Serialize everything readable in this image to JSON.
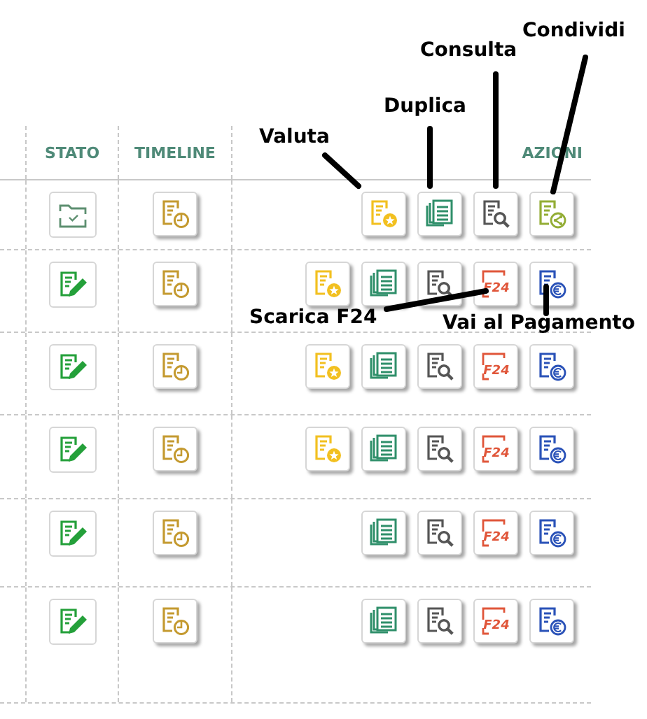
{
  "table": {
    "columns": [
      {
        "label": "STATO"
      },
      {
        "label": "TIMELINE"
      },
      {
        "label": "AZIONI"
      }
    ],
    "rows": [
      {
        "stato": {
          "kind": "folder-check"
        },
        "actions": [
          {
            "kind": "valuta"
          },
          {
            "kind": "duplica"
          },
          {
            "kind": "consulta"
          },
          {
            "kind": "condividi"
          }
        ]
      },
      {
        "stato": {
          "kind": "edit"
        },
        "actions": [
          {
            "kind": "valuta"
          },
          {
            "kind": "duplica"
          },
          {
            "kind": "consulta"
          },
          {
            "kind": "f24",
            "text": "F24"
          },
          {
            "kind": "pagamento"
          }
        ]
      },
      {
        "stato": {
          "kind": "edit"
        },
        "actions": [
          {
            "kind": "valuta"
          },
          {
            "kind": "duplica"
          },
          {
            "kind": "consulta"
          },
          {
            "kind": "f24",
            "text": "F24"
          },
          {
            "kind": "pagamento"
          }
        ]
      },
      {
        "stato": {
          "kind": "edit"
        },
        "actions": [
          {
            "kind": "valuta"
          },
          {
            "kind": "duplica"
          },
          {
            "kind": "consulta"
          },
          {
            "kind": "f24",
            "text": "F24"
          },
          {
            "kind": "pagamento"
          }
        ]
      },
      {
        "stato": {
          "kind": "edit"
        },
        "actions": [
          {
            "kind": "duplica"
          },
          {
            "kind": "consulta"
          },
          {
            "kind": "f24",
            "text": "F24"
          },
          {
            "kind": "pagamento"
          }
        ]
      },
      {
        "stato": {
          "kind": "edit"
        },
        "actions": [
          {
            "kind": "duplica"
          },
          {
            "kind": "consulta"
          },
          {
            "kind": "f24",
            "text": "F24"
          },
          {
            "kind": "pagamento"
          }
        ]
      }
    ]
  },
  "callouts": [
    {
      "text": "Valuta"
    },
    {
      "text": "Duplica"
    },
    {
      "text": "Consulta"
    },
    {
      "text": "Condividi"
    },
    {
      "text": "Scarica F24"
    },
    {
      "text": "Vai al Pagamento"
    }
  ]
}
